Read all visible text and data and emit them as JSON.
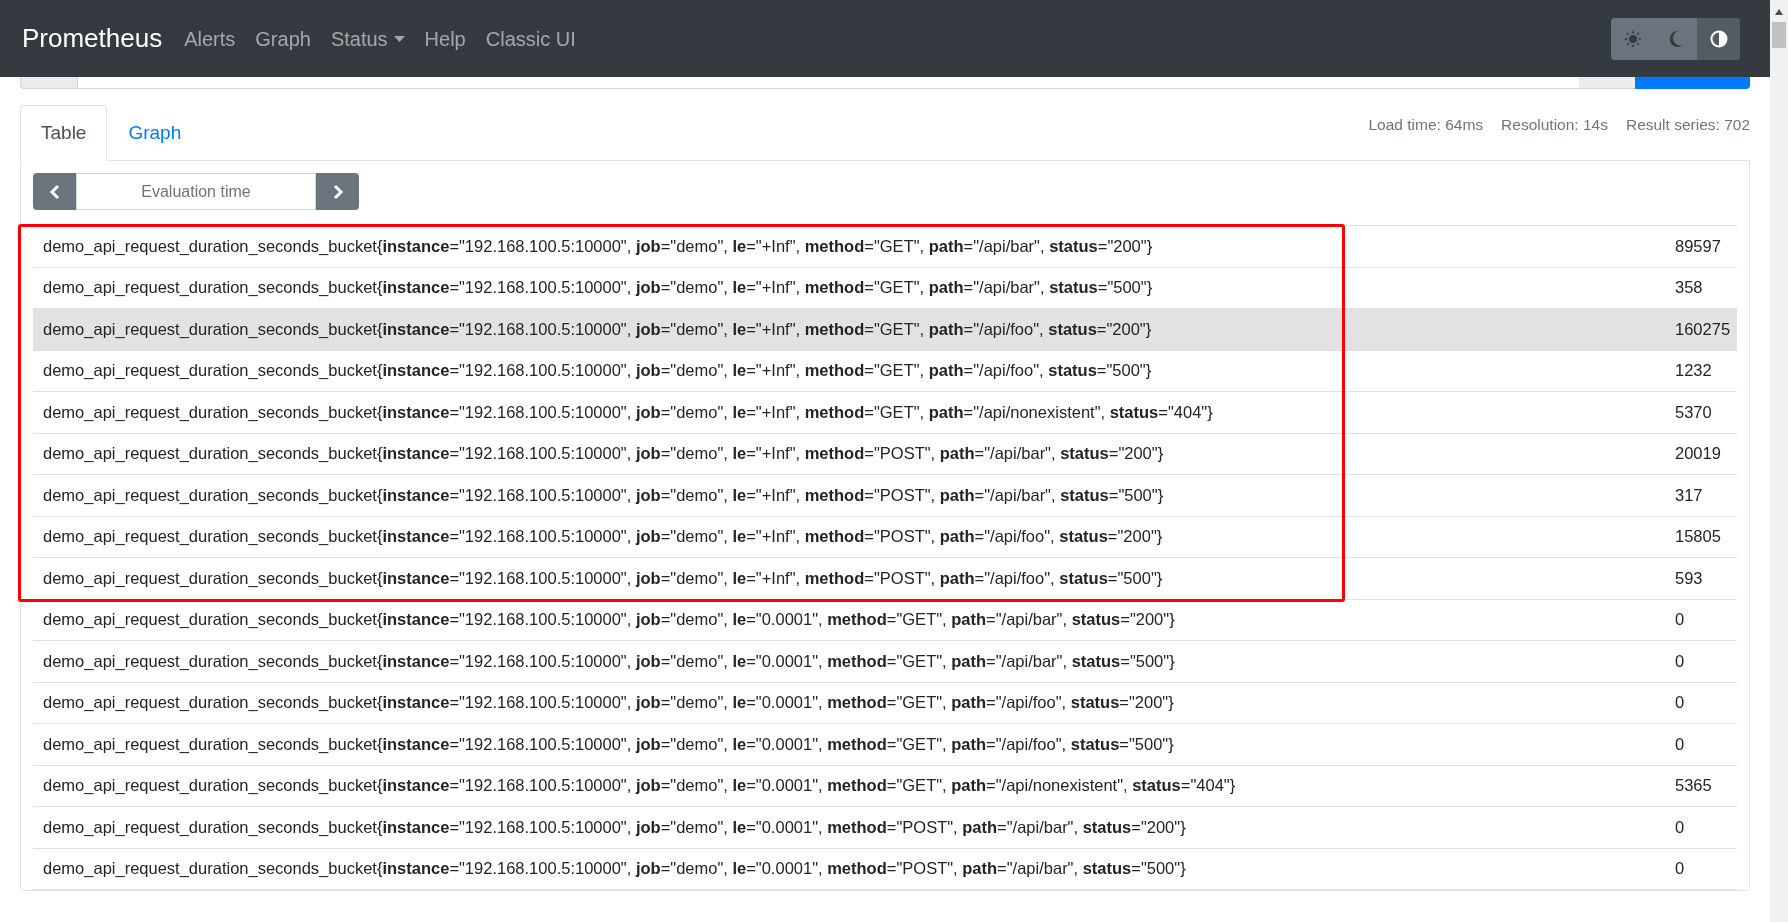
{
  "navbar": {
    "brand": "Prometheus",
    "links": [
      {
        "label": "Alerts",
        "dropdown": false
      },
      {
        "label": "Graph",
        "dropdown": false
      },
      {
        "label": "Status",
        "dropdown": true
      },
      {
        "label": "Help",
        "dropdown": false
      },
      {
        "label": "Classic UI",
        "dropdown": false
      }
    ],
    "theme_buttons": [
      {
        "kind": "light",
        "selected": false
      },
      {
        "kind": "dark",
        "selected": false
      },
      {
        "kind": "auto",
        "selected": true
      }
    ]
  },
  "tabs": [
    {
      "label": "Table",
      "selected": true
    },
    {
      "label": "Graph",
      "selected": false
    }
  ],
  "stats": [
    "Load time: 64ms",
    "Resolution: 14s",
    "Result series: 702"
  ],
  "evaluation_time": {
    "placeholder": "Evaluation time"
  },
  "highlighted_rows": [
    {
      "series": "demo_api_request_duration_seconds_bucket{**instance**=\"192.168.100.5:10000\", **job**=\"demo\", **le**=\"+Inf\", **method**=\"GET\", **path**=\"/api/bar\", **status**=\"200\"}",
      "value": "89597",
      "hovered": false
    },
    {
      "series": "demo_api_request_duration_seconds_bucket{**instance**=\"192.168.100.5:10000\", **job**=\"demo\", **le**=\"+Inf\", **method**=\"GET\", **path**=\"/api/bar\", **status**=\"500\"}",
      "value": "358",
      "hovered": false
    },
    {
      "series": "demo_api_request_duration_seconds_bucket{**instance**=\"192.168.100.5:10000\", **job**=\"demo\", **le**=\"+Inf\", **method**=\"GET\", **path**=\"/api/foo\", **status**=\"200\"}",
      "value": "160275",
      "hovered": true
    },
    {
      "series": "demo_api_request_duration_seconds_bucket{**instance**=\"192.168.100.5:10000\", **job**=\"demo\", **le**=\"+Inf\", **method**=\"GET\", **path**=\"/api/foo\", **status**=\"500\"}",
      "value": "1232",
      "hovered": false
    },
    {
      "series": "demo_api_request_duration_seconds_bucket{**instance**=\"192.168.100.5:10000\", **job**=\"demo\", **le**=\"+Inf\", **method**=\"GET\", **path**=\"/api/nonexistent\", **status**=\"404\"}",
      "value": "5370",
      "hovered": false
    },
    {
      "series": "demo_api_request_duration_seconds_bucket{**instance**=\"192.168.100.5:10000\", **job**=\"demo\", **le**=\"+Inf\", **method**=\"POST\", **path**=\"/api/bar\", **status**=\"200\"}",
      "value": "20019",
      "hovered": false
    },
    {
      "series": "demo_api_request_duration_seconds_bucket{**instance**=\"192.168.100.5:10000\", **job**=\"demo\", **le**=\"+Inf\", **method**=\"POST\", **path**=\"/api/bar\", **status**=\"500\"}",
      "value": "317",
      "hovered": false
    },
    {
      "series": "demo_api_request_duration_seconds_bucket{**instance**=\"192.168.100.5:10000\", **job**=\"demo\", **le**=\"+Inf\", **method**=\"POST\", **path**=\"/api/foo\", **status**=\"200\"}",
      "value": "15805",
      "hovered": false
    },
    {
      "series": "demo_api_request_duration_seconds_bucket{**instance**=\"192.168.100.5:10000\", **job**=\"demo\", **le**=\"+Inf\", **method**=\"POST\", **path**=\"/api/foo\", **status**=\"500\"}",
      "value": "593",
      "hovered": false
    }
  ],
  "rows": [
    {
      "series": "demo_api_request_duration_seconds_bucket{**instance**=\"192.168.100.5:10000\", **job**=\"demo\", **le**=\"0.0001\", **method**=\"GET\", **path**=\"/api/bar\", **status**=\"200\"}",
      "value": "0",
      "hovered": false
    },
    {
      "series": "demo_api_request_duration_seconds_bucket{**instance**=\"192.168.100.5:10000\", **job**=\"demo\", **le**=\"0.0001\", **method**=\"GET\", **path**=\"/api/bar\", **status**=\"500\"}",
      "value": "0",
      "hovered": false
    },
    {
      "series": "demo_api_request_duration_seconds_bucket{**instance**=\"192.168.100.5:10000\", **job**=\"demo\", **le**=\"0.0001\", **method**=\"GET\", **path**=\"/api/foo\", **status**=\"200\"}",
      "value": "0",
      "hovered": false
    },
    {
      "series": "demo_api_request_duration_seconds_bucket{**instance**=\"192.168.100.5:10000\", **job**=\"demo\", **le**=\"0.0001\", **method**=\"GET\", **path**=\"/api/foo\", **status**=\"500\"}",
      "value": "0",
      "hovered": false
    },
    {
      "series": "demo_api_request_duration_seconds_bucket{**instance**=\"192.168.100.5:10000\", **job**=\"demo\", **le**=\"0.0001\", **method**=\"GET\", **path**=\"/api/nonexistent\", **status**=\"404\"}",
      "value": "5365",
      "hovered": false
    },
    {
      "series": "demo_api_request_duration_seconds_bucket{**instance**=\"192.168.100.5:10000\", **job**=\"demo\", **le**=\"0.0001\", **method**=\"POST\", **path**=\"/api/bar\", **status**=\"200\"}",
      "value": "0",
      "hovered": false
    },
    {
      "series": "demo_api_request_duration_seconds_bucket{**instance**=\"192.168.100.5:10000\", **job**=\"demo\", **le**=\"0.0001\", **method**=\"POST\", **path**=\"/api/bar\", **status**=\"500\"}",
      "value": "0",
      "hovered": false
    }
  ]
}
